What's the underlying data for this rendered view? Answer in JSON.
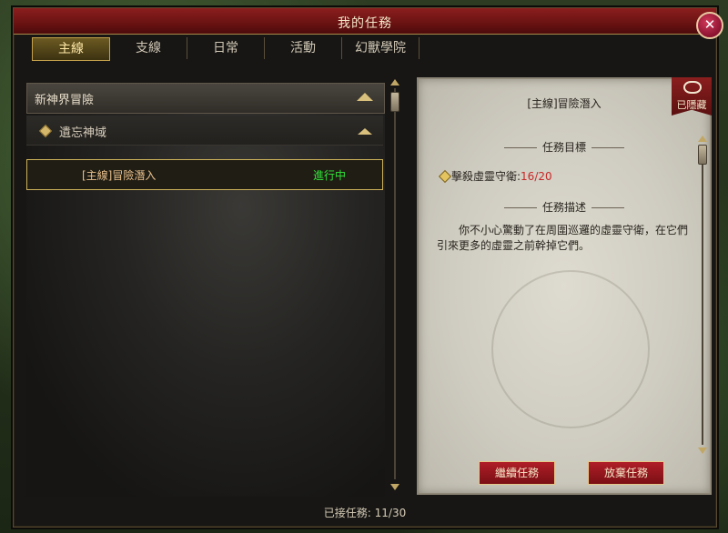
{
  "window": {
    "title": "我的任務"
  },
  "tabs": [
    {
      "label": "主線",
      "active": true
    },
    {
      "label": "支線",
      "active": false
    },
    {
      "label": "日常",
      "active": false
    },
    {
      "label": "活動",
      "active": false
    },
    {
      "label": "幻獸學院",
      "active": false
    }
  ],
  "quest_list": {
    "category": "新神界冒險",
    "subcategory": "遺忘神域",
    "quest": {
      "name": "[主線]冒險潛入",
      "status": "進行中"
    }
  },
  "detail": {
    "title": "[主線]冒險潛入",
    "hide_badge": "已隱藏",
    "objective_header": "任務目標",
    "objective_text": "擊殺虛靈守衛:",
    "objective_count": "16/20",
    "description_header": "任務描述",
    "description": "你不小心驚動了在周圍巡邏的虛靈守衛，在它們引來更多的虛靈之前幹掉它們。"
  },
  "buttons": {
    "continue": "繼續任務",
    "abandon": "放棄任務"
  },
  "footer": {
    "accepted_label": "已接任務:",
    "accepted_count": "11/30"
  },
  "colors": {
    "accent_red": "#8b1e1e",
    "status_green": "#31e63a",
    "count_red": "#c82828"
  }
}
